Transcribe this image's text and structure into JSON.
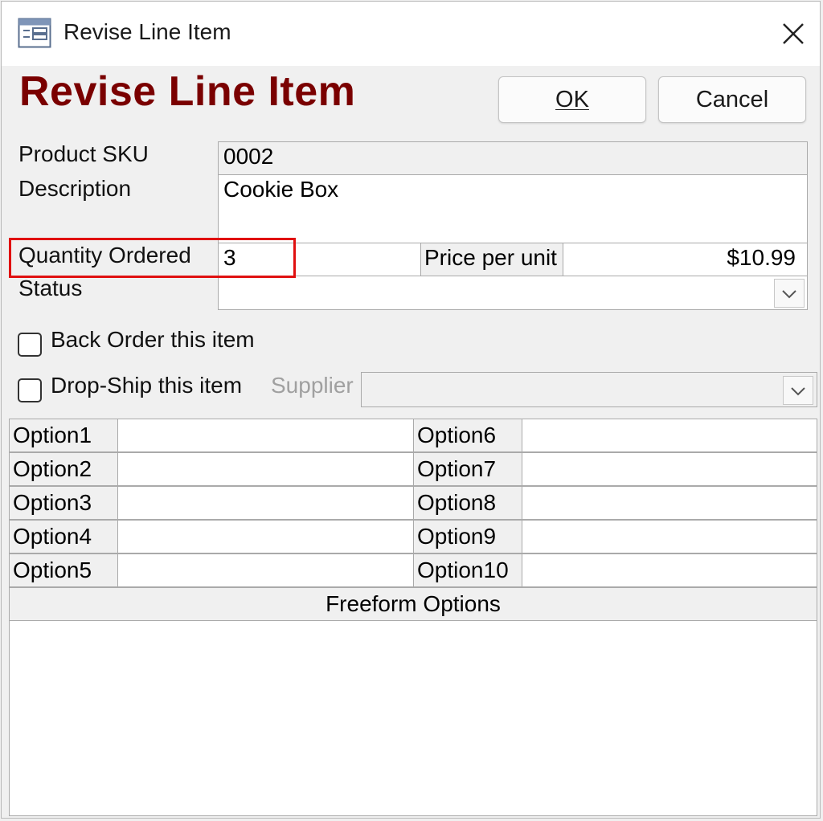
{
  "window": {
    "title": "Revise Line Item"
  },
  "form": {
    "heading": "Revise Line Item",
    "ok_label": "OK",
    "cancel_label": "Cancel"
  },
  "fields": {
    "product_sku_label": "Product SKU",
    "product_sku_value": "0002",
    "description_label": "Description",
    "description_value": "Cookie Box",
    "quantity_label": "Quantity Ordered",
    "quantity_value": "3",
    "price_label": "Price per unit",
    "price_value": "$10.99",
    "status_label": "Status",
    "status_value": ""
  },
  "checkboxes": {
    "back_order_label": "Back Order this item",
    "back_order_checked": false,
    "drop_ship_label": "Drop-Ship this item",
    "drop_ship_checked": false,
    "supplier_label": "Supplier",
    "supplier_value": ""
  },
  "options": {
    "left": [
      {
        "label": "Option1",
        "value": ""
      },
      {
        "label": "Option2",
        "value": ""
      },
      {
        "label": "Option3",
        "value": ""
      },
      {
        "label": "Option4",
        "value": ""
      },
      {
        "label": "Option5",
        "value": ""
      }
    ],
    "right": [
      {
        "label": "Option6",
        "value": ""
      },
      {
        "label": "Option7",
        "value": ""
      },
      {
        "label": "Option8",
        "value": ""
      },
      {
        "label": "Option9",
        "value": ""
      },
      {
        "label": "Option10",
        "value": ""
      }
    ],
    "freeform_header": "Freeform Options",
    "freeform_value": ""
  },
  "colors": {
    "heading": "#7a0000",
    "highlight": "#e01010"
  },
  "icons": {
    "app": "form-icon",
    "close": "close-icon",
    "dropdown": "chevron-down-icon"
  }
}
